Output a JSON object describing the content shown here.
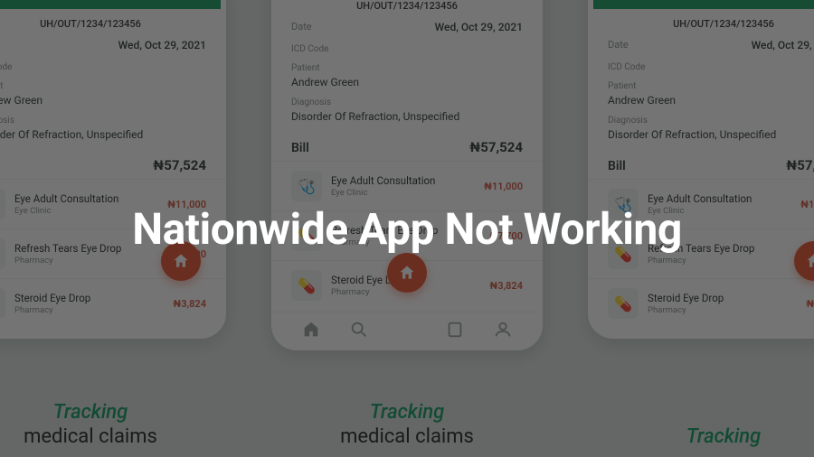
{
  "headline": "Nationwide App Not Working",
  "phone": {
    "ref": "UH/OUT/1234/123456",
    "date_label": "Date",
    "date_value": "Wed, Oct 29, 2021",
    "code_label": "ICD Code",
    "patient_label": "Patient",
    "patient_name": "Andrew Green",
    "diagnosis_label": "Diagnosis",
    "diagnosis_value": "Disorder Of Refraction, Unspecified",
    "bill_label": "Bill",
    "bill_amount": "₦57,524",
    "items": [
      {
        "title": "Eye Adult Consultation",
        "sub": "Eye Clinic",
        "price": "₦11,000"
      },
      {
        "title": "Refresh Tears Eye Drop",
        "sub": "Pharmacy",
        "price": "₦7,700"
      },
      {
        "title": "Steroid Eye Drop",
        "sub": "Pharmacy",
        "price": "₦3,824"
      }
    ]
  },
  "caption_line1": "Tracking",
  "caption_line2": "medical claims",
  "caption_right": "Tracking"
}
